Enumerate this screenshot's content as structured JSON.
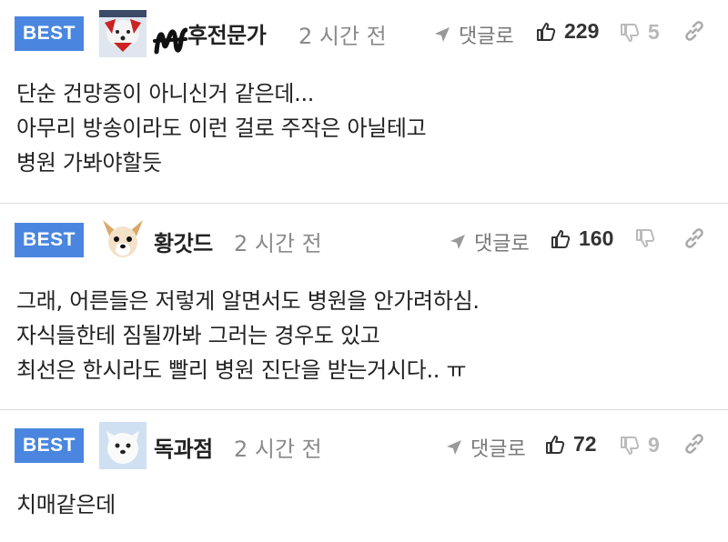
{
  "comments": [
    {
      "badge": "BEST",
      "nickname": "후전문가",
      "time": "2 시간 전",
      "reply_label": "댓글로",
      "likes": "229",
      "dislikes": "5",
      "avatar_icon": "white-dog-avatar-icon",
      "lines": [
        "단순 건망증이 아니신거 같은데...",
        "아무리 방송이라도 이런 걸로 주작은 아닐테고",
        "병원 가봐야할듯"
      ]
    },
    {
      "badge": "BEST",
      "nickname": "황갓드",
      "time": "2 시간 전",
      "reply_label": "댓글로",
      "likes": "160",
      "dislikes": "",
      "avatar_icon": "chihuahua-avatar-icon",
      "lines": [
        "그래, 어른들은 저렇게 알면서도 병원을 안가려하심.",
        "자식들한테 짐될까봐 그러는 경우도 있고",
        "최선은 한시라도 빨리 병원 진단을 받는거시다.. ㅠ"
      ]
    },
    {
      "badge": "BEST",
      "nickname": "독과점",
      "time": "2 시간 전",
      "reply_label": "댓글로",
      "likes": "72",
      "dislikes": "9",
      "avatar_icon": "white-dog-avatar-icon",
      "lines": [
        "치매같은데"
      ]
    }
  ],
  "colors": {
    "best_badge": "#4a86e0",
    "time": "#8a8a8a",
    "dislike": "#b8b8b8"
  }
}
